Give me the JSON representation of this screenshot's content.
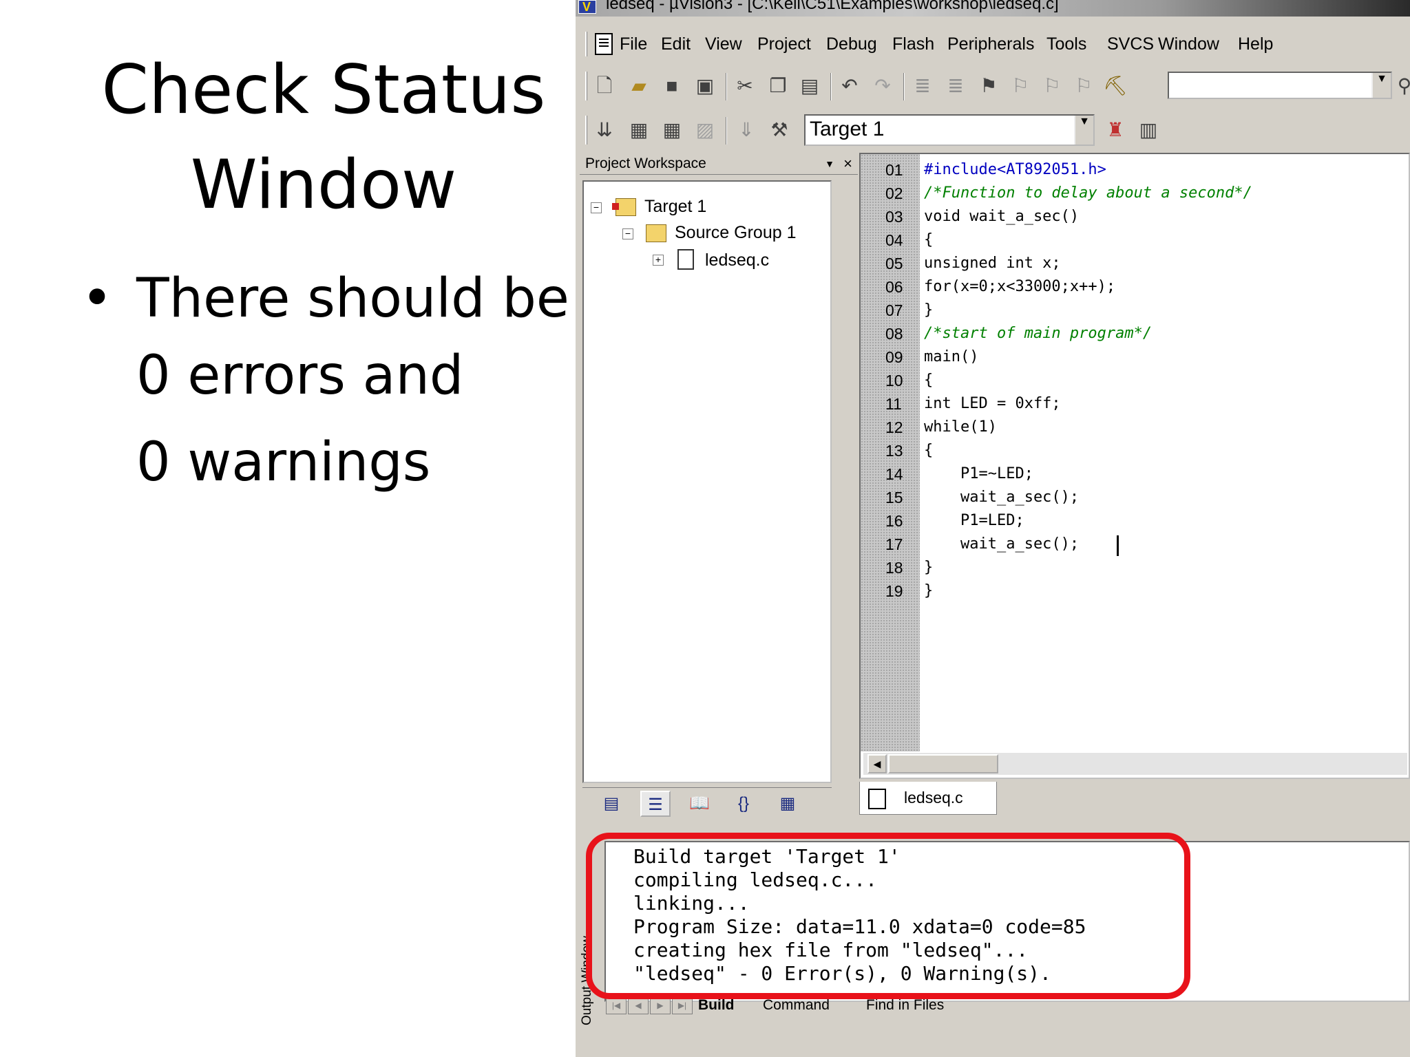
{
  "slide": {
    "title_line1": "Check Status",
    "title_line2": "Window",
    "bullet_line1": "There should be",
    "bullet_line2": "0 errors and",
    "bullet_line3": "0 warnings",
    "bullet_glyph": "•"
  },
  "window": {
    "title": "ledseq  - µVision3 - [C:\\Keil\\C51\\Examples\\workshop\\ledseq.c]"
  },
  "menu": [
    "File",
    "Edit",
    "View",
    "Project",
    "Debug",
    "Flash",
    "Peripherals",
    "Tools",
    "SVCS",
    "Window",
    "Help"
  ],
  "toolbar": {
    "target_select": "Target 1",
    "find_combo": ""
  },
  "workspace": {
    "header": "Project Workspace",
    "tree": {
      "target": "Target 1",
      "group": "Source Group 1",
      "file": "ledseq.c"
    }
  },
  "editor": {
    "tab_label": "ledseq.c",
    "line_numbers": [
      "01",
      "02",
      "03",
      "04",
      "05",
      "06",
      "07",
      "08",
      "09",
      "10",
      "11",
      "12",
      "13",
      "14",
      "15",
      "16",
      "17",
      "18",
      "19"
    ],
    "lines": [
      "#include<AT892051.h>",
      "/*Function to delay about a second*/",
      "void wait_a_sec()",
      "{",
      "unsigned int x;",
      "for(x=0;x<33000;x++);",
      "}",
      "/*start of main program*/",
      "main()",
      "{",
      "int LED = 0xff;",
      "while(1)",
      "{",
      "    P1=~LED;",
      "    wait_a_sec();",
      "    P1=LED;",
      "    wait_a_sec();",
      "}",
      "}"
    ]
  },
  "output": {
    "side_label": "Output Window",
    "lines": [
      "Build target 'Target 1'",
      "compiling ledseq.c...",
      "linking...",
      "Program Size: data=11.0 xdata=0 code=85",
      "creating hex file from \"ledseq\"...",
      "\"ledseq\" - 0 Error(s), 0 Warning(s)."
    ],
    "tabs": [
      "Build",
      "Command",
      "Find in Files"
    ]
  },
  "colors": {
    "highlight": "#e8121a",
    "comment": "#008000",
    "preprocessor": "#0000c0",
    "number": "#800080"
  }
}
